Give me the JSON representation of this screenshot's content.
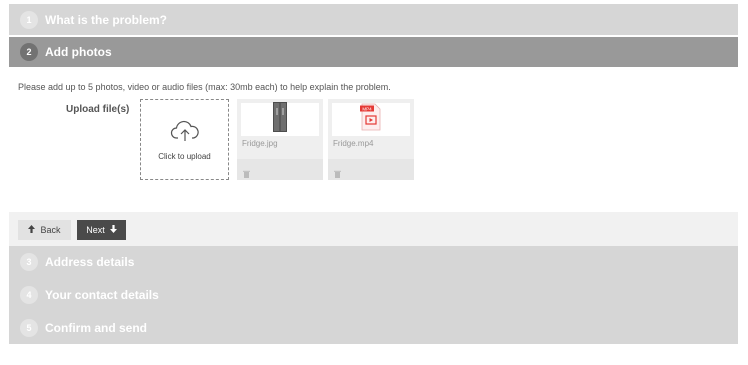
{
  "steps": {
    "step1": {
      "num": "1",
      "title": "What is the problem?"
    },
    "step2": {
      "num": "2",
      "title": "Add photos"
    },
    "step3": {
      "num": "3",
      "title": "Address details"
    },
    "step4": {
      "num": "4",
      "title": "Your contact details"
    },
    "step5": {
      "num": "5",
      "title": "Confirm and send"
    }
  },
  "upload": {
    "instructions": "Please add up to 5 photos, video or audio files (max: 30mb each) to help explain the problem.",
    "label": "Upload file(s)",
    "dropzone_label": "Click to upload",
    "files": [
      {
        "name": "Fridge.jpg",
        "type": "image",
        "icon": "fridge-image"
      },
      {
        "name": "Fridge.mp4",
        "type": "video",
        "icon": "mp4-file-icon",
        "badge": "MP4"
      }
    ]
  },
  "nav": {
    "back_label": "Back",
    "next_label": "Next"
  },
  "colors": {
    "header_active": "#999999",
    "header_inactive": "#d6d6d6",
    "next_button": "#4a4a4a",
    "file_badge": "#e53935"
  }
}
